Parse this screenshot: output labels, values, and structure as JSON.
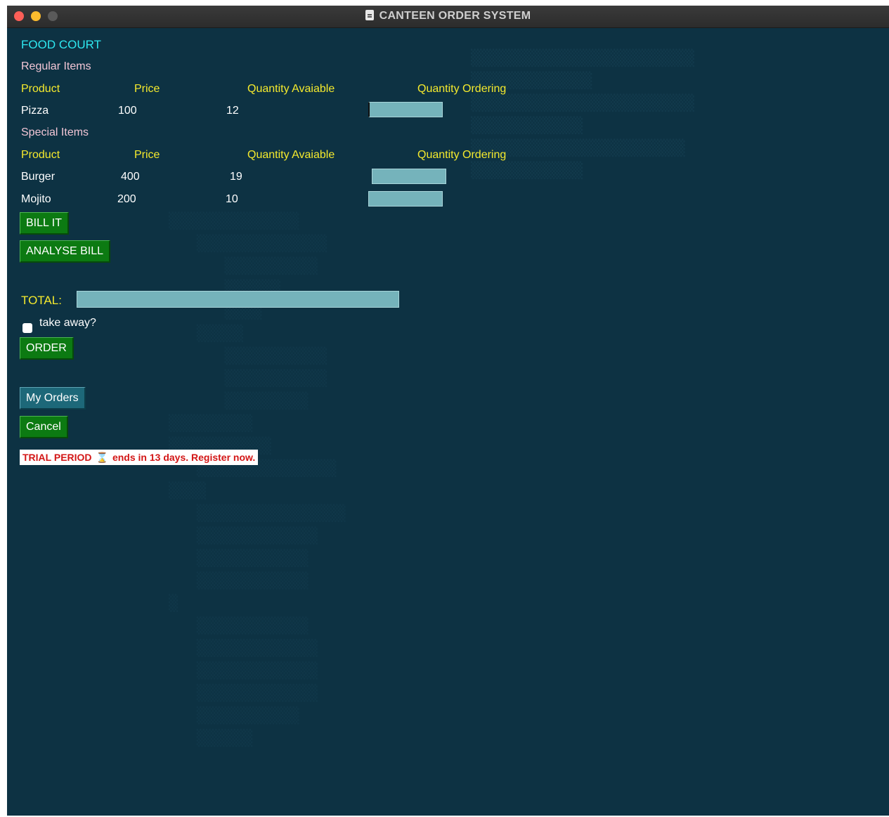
{
  "window": {
    "title": "CANTEEN ORDER SYSTEM"
  },
  "app": {
    "heading": "FOOD COURT",
    "regular": {
      "section_label": "Regular Items",
      "headers": [
        "Product",
        "Price",
        "Quantity Avaiable",
        "Quantity Ordering"
      ],
      "rows": [
        {
          "product": "Pizza",
          "price": "100",
          "available": "12",
          "ordering": ""
        }
      ]
    },
    "special": {
      "section_label": "Special Items",
      "headers": [
        "Product",
        "Price",
        "Quantity Avaiable",
        "Quantity Ordering"
      ],
      "rows": [
        {
          "product": "Burger",
          "price": "400",
          "available": "19",
          "ordering": ""
        },
        {
          "product": "Mojito",
          "price": "200",
          "available": "10",
          "ordering": ""
        }
      ]
    },
    "buttons": {
      "bill": "BILL IT",
      "analyse": "ANALYSE BILL",
      "order": "ORDER",
      "my_orders": "My Orders",
      "cancel": "Cancel"
    },
    "total": {
      "label": "TOTAL:",
      "value": ""
    },
    "takeaway": {
      "label": "take away?",
      "checked": false
    },
    "trial_banner": {
      "prefix": "TRIAL PERIOD",
      "suffix": "ends in 13 days. Register now."
    }
  },
  "colors": {
    "background": "#0d3243",
    "heading": "#2ee8f0",
    "section": "#f2c6d6",
    "header": "#f5ea2d",
    "button": "#0c7a12",
    "button_alt": "#1d6879",
    "entry": "#75b3bb",
    "trial_text": "#d31616"
  },
  "icons": {
    "title_icon": "document-icon",
    "trial_icon": "hourglass-icon"
  }
}
